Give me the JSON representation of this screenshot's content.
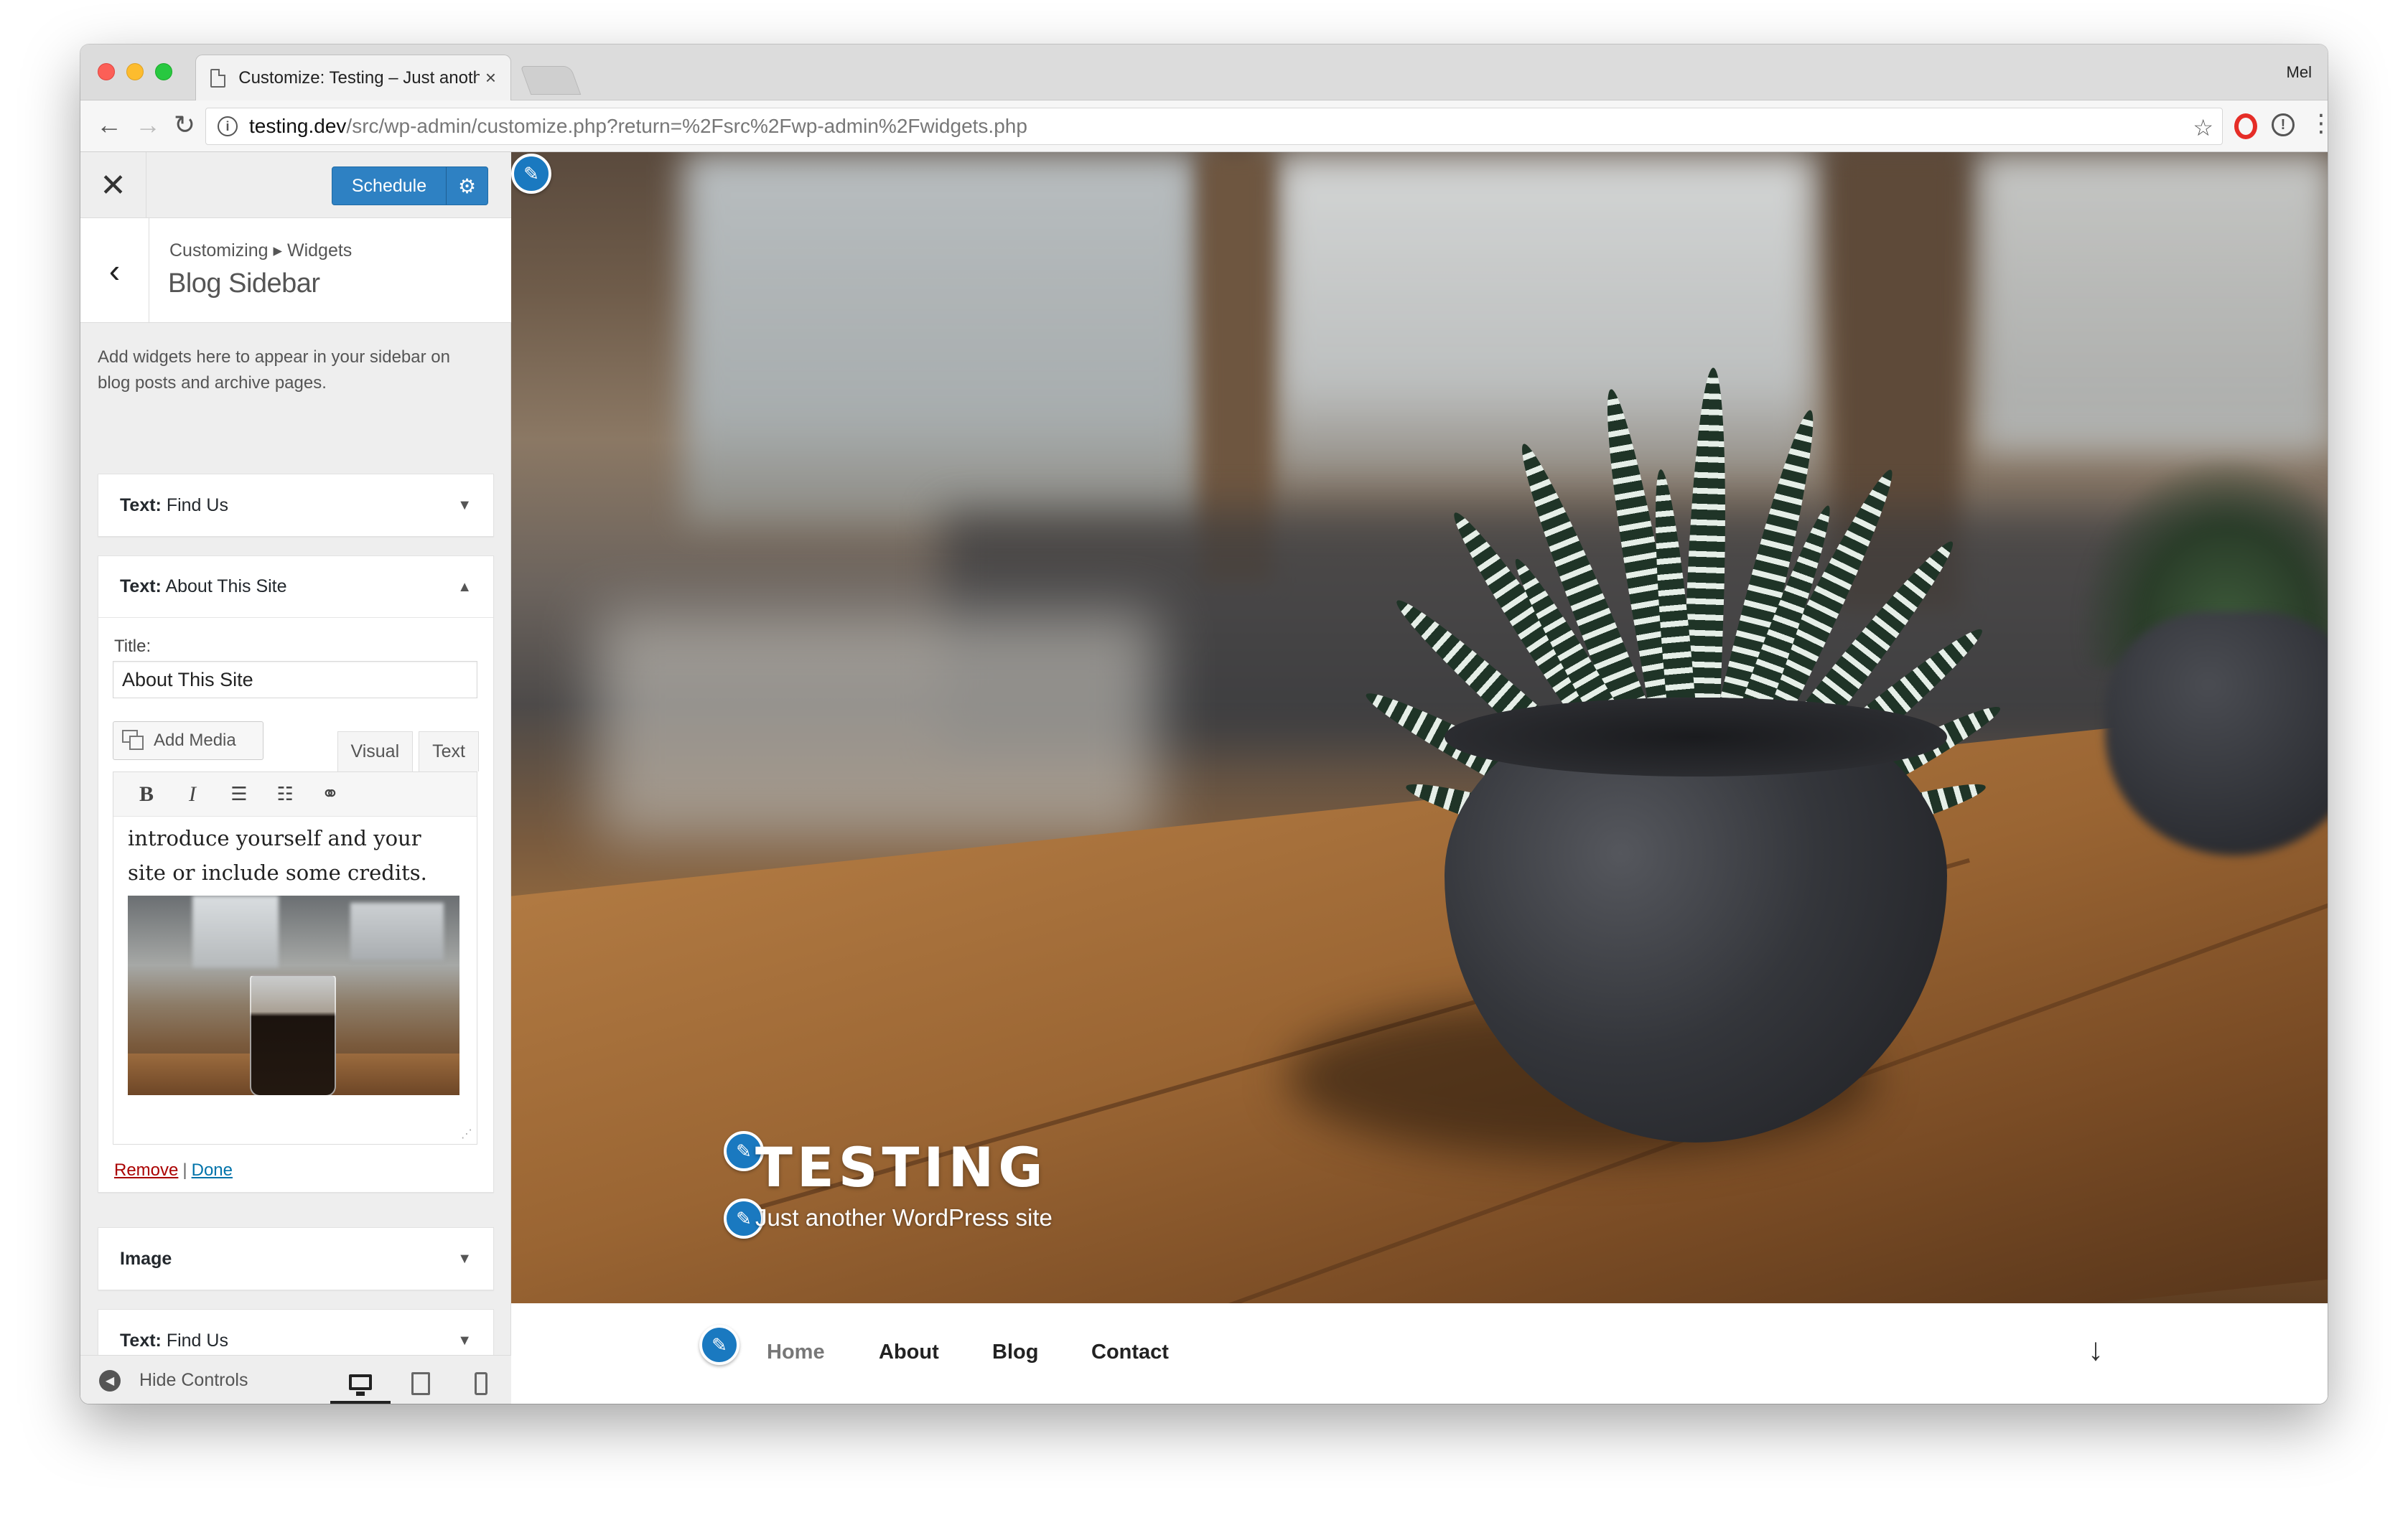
{
  "browser": {
    "tab_title": "Customize: Testing – Just another WordPress site",
    "tab_close": "×",
    "profile": "Mel",
    "url_host": "testing.dev",
    "url_path": "/src/wp-admin/customize.php?return=%2Fsrc%2Fwp-admin%2Fwidgets.php",
    "back": "←",
    "forward": "→",
    "reload": "↻",
    "star": "☆",
    "menu": "⋮"
  },
  "customizer": {
    "close": "✕",
    "schedule_label": "Schedule",
    "gear": "⚙",
    "back": "‹",
    "breadcrumb": "Customizing ▸ Widgets",
    "panel_title": "Blog Sidebar",
    "description": "Add widgets here to appear in your sidebar on blog posts and archive pages."
  },
  "widgets": {
    "w1": {
      "prefix": "Text:",
      "name": " Find Us",
      "arrow": "▼"
    },
    "w2": {
      "prefix": "Text:",
      "name": " About This Site",
      "arrow": "▲",
      "title_label": "Title:",
      "title_value": "About This Site",
      "add_media": "Add Media",
      "tab_visual": "Visual",
      "tab_text": "Text",
      "content": "introduce yourself and your site or include some credits.",
      "remove": "Remove",
      "separator": "|",
      "done": "Done"
    },
    "w3": {
      "name": "Image",
      "arrow": "▼"
    },
    "w4": {
      "prefix": "Text:",
      "name": " Find Us",
      "arrow": "▼"
    }
  },
  "editor_toolbar": {
    "bold": "B",
    "italic": "I",
    "bullet": "☰",
    "numbered": "☷",
    "link": "⚭"
  },
  "footer": {
    "hide_label": "Hide Controls",
    "hide_icon": "◀"
  },
  "preview": {
    "site_title": "TESTING",
    "tagline": "Just another WordPress site",
    "pencil": "✎",
    "nav": [
      "Home",
      "About",
      "Blog",
      "Contact"
    ],
    "scroll_arrow": "↓"
  },
  "colors": {
    "primary": "#2e81c3",
    "pencil": "#1a79c0",
    "remove_link": "#aa0000",
    "done_link": "#0073aa"
  }
}
